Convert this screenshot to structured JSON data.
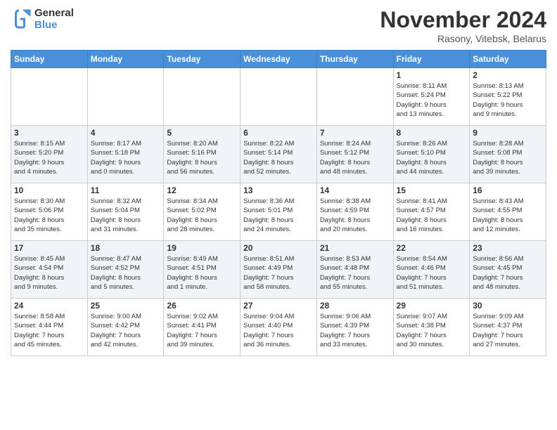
{
  "logo": {
    "line1": "General",
    "line2": "Blue"
  },
  "title": "November 2024",
  "subtitle": "Rasony, Vitebsk, Belarus",
  "weekdays": [
    "Sunday",
    "Monday",
    "Tuesday",
    "Wednesday",
    "Thursday",
    "Friday",
    "Saturday"
  ],
  "weeks": [
    [
      {
        "day": "",
        "info": ""
      },
      {
        "day": "",
        "info": ""
      },
      {
        "day": "",
        "info": ""
      },
      {
        "day": "",
        "info": ""
      },
      {
        "day": "",
        "info": ""
      },
      {
        "day": "1",
        "info": "Sunrise: 8:11 AM\nSunset: 5:24 PM\nDaylight: 9 hours\nand 13 minutes."
      },
      {
        "day": "2",
        "info": "Sunrise: 8:13 AM\nSunset: 5:22 PM\nDaylight: 9 hours\nand 9 minutes."
      }
    ],
    [
      {
        "day": "3",
        "info": "Sunrise: 8:15 AM\nSunset: 5:20 PM\nDaylight: 9 hours\nand 4 minutes."
      },
      {
        "day": "4",
        "info": "Sunrise: 8:17 AM\nSunset: 5:18 PM\nDaylight: 9 hours\nand 0 minutes."
      },
      {
        "day": "5",
        "info": "Sunrise: 8:20 AM\nSunset: 5:16 PM\nDaylight: 8 hours\nand 56 minutes."
      },
      {
        "day": "6",
        "info": "Sunrise: 8:22 AM\nSunset: 5:14 PM\nDaylight: 8 hours\nand 52 minutes."
      },
      {
        "day": "7",
        "info": "Sunrise: 8:24 AM\nSunset: 5:12 PM\nDaylight: 8 hours\nand 48 minutes."
      },
      {
        "day": "8",
        "info": "Sunrise: 8:26 AM\nSunset: 5:10 PM\nDaylight: 8 hours\nand 44 minutes."
      },
      {
        "day": "9",
        "info": "Sunrise: 8:28 AM\nSunset: 5:08 PM\nDaylight: 8 hours\nand 39 minutes."
      }
    ],
    [
      {
        "day": "10",
        "info": "Sunrise: 8:30 AM\nSunset: 5:06 PM\nDaylight: 8 hours\nand 35 minutes."
      },
      {
        "day": "11",
        "info": "Sunrise: 8:32 AM\nSunset: 5:04 PM\nDaylight: 8 hours\nand 31 minutes."
      },
      {
        "day": "12",
        "info": "Sunrise: 8:34 AM\nSunset: 5:02 PM\nDaylight: 8 hours\nand 28 minutes."
      },
      {
        "day": "13",
        "info": "Sunrise: 8:36 AM\nSunset: 5:01 PM\nDaylight: 8 hours\nand 24 minutes."
      },
      {
        "day": "14",
        "info": "Sunrise: 8:38 AM\nSunset: 4:59 PM\nDaylight: 8 hours\nand 20 minutes."
      },
      {
        "day": "15",
        "info": "Sunrise: 8:41 AM\nSunset: 4:57 PM\nDaylight: 8 hours\nand 16 minutes."
      },
      {
        "day": "16",
        "info": "Sunrise: 8:43 AM\nSunset: 4:55 PM\nDaylight: 8 hours\nand 12 minutes."
      }
    ],
    [
      {
        "day": "17",
        "info": "Sunrise: 8:45 AM\nSunset: 4:54 PM\nDaylight: 8 hours\nand 9 minutes."
      },
      {
        "day": "18",
        "info": "Sunrise: 8:47 AM\nSunset: 4:52 PM\nDaylight: 8 hours\nand 5 minutes."
      },
      {
        "day": "19",
        "info": "Sunrise: 8:49 AM\nSunset: 4:51 PM\nDaylight: 8 hours\nand 1 minute."
      },
      {
        "day": "20",
        "info": "Sunrise: 8:51 AM\nSunset: 4:49 PM\nDaylight: 7 hours\nand 58 minutes."
      },
      {
        "day": "21",
        "info": "Sunrise: 8:53 AM\nSunset: 4:48 PM\nDaylight: 7 hours\nand 55 minutes."
      },
      {
        "day": "22",
        "info": "Sunrise: 8:54 AM\nSunset: 4:46 PM\nDaylight: 7 hours\nand 51 minutes."
      },
      {
        "day": "23",
        "info": "Sunrise: 8:56 AM\nSunset: 4:45 PM\nDaylight: 7 hours\nand 48 minutes."
      }
    ],
    [
      {
        "day": "24",
        "info": "Sunrise: 8:58 AM\nSunset: 4:44 PM\nDaylight: 7 hours\nand 45 minutes."
      },
      {
        "day": "25",
        "info": "Sunrise: 9:00 AM\nSunset: 4:42 PM\nDaylight: 7 hours\nand 42 minutes."
      },
      {
        "day": "26",
        "info": "Sunrise: 9:02 AM\nSunset: 4:41 PM\nDaylight: 7 hours\nand 39 minutes."
      },
      {
        "day": "27",
        "info": "Sunrise: 9:04 AM\nSunset: 4:40 PM\nDaylight: 7 hours\nand 36 minutes."
      },
      {
        "day": "28",
        "info": "Sunrise: 9:06 AM\nSunset: 4:39 PM\nDaylight: 7 hours\nand 33 minutes."
      },
      {
        "day": "29",
        "info": "Sunrise: 9:07 AM\nSunset: 4:38 PM\nDaylight: 7 hours\nand 30 minutes."
      },
      {
        "day": "30",
        "info": "Sunrise: 9:09 AM\nSunset: 4:37 PM\nDaylight: 7 hours\nand 27 minutes."
      }
    ]
  ]
}
